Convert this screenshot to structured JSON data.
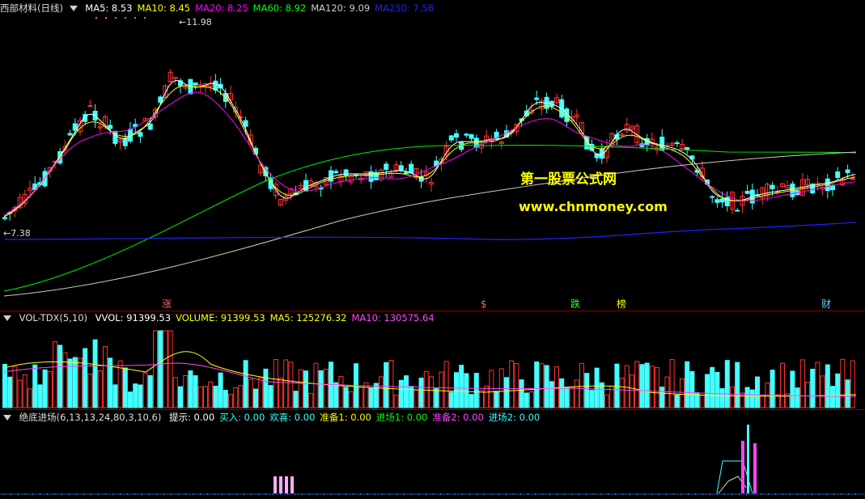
{
  "main_panel": {
    "title": "西部材料(日线)",
    "ma": [
      {
        "label": "MA5: 8.53",
        "color": "#ffffff"
      },
      {
        "label": "MA10: 8.45",
        "color": "#ffff00"
      },
      {
        "label": "MA20: 8.25",
        "color": "#ff00ff"
      },
      {
        "label": "MA60: 8.92",
        "color": "#00ff00"
      },
      {
        "label": "MA120: 9.09",
        "color": "#cccccc"
      },
      {
        "label": "MA250: 7.58",
        "color": "#2020ff"
      }
    ],
    "high_label": "11.98",
    "low_label": "7.38",
    "watermark_title": "第一股票公式网",
    "watermark_url": "www.chnmoney.com",
    "event_markers": [
      "涨",
      "$",
      "跌",
      "榜",
      "财"
    ]
  },
  "volume_panel": {
    "title": "VOL-TDX(5,10)",
    "items": [
      {
        "label": "VVOL: 91399.53",
        "color": "#ffffff"
      },
      {
        "label": "VOLUME: 91399.53",
        "color": "#ffff00"
      },
      {
        "label": "MA5: 125276.32",
        "color": "#ffff00"
      },
      {
        "label": "MA10: 130575.64",
        "color": "#ff44ff"
      }
    ]
  },
  "indicator_panel": {
    "title": "绝底进场(6,13,13,24,80,3,10,6)",
    "items": [
      {
        "label": "提示: 0.00",
        "color": "#ffffff"
      },
      {
        "label": "买入: 0.00",
        "color": "#33ffff"
      },
      {
        "label": "欢喜: 0.00",
        "color": "#33ffff"
      },
      {
        "label": "准备1: 0.00",
        "color": "#ffff00"
      },
      {
        "label": "进场1: 0.00",
        "color": "#00ff00"
      },
      {
        "label": "准备2: 0.00",
        "color": "#ff44ff"
      },
      {
        "label": "进场2: 0.00",
        "color": "#33ffff"
      }
    ]
  },
  "colors": {
    "up": "#ff3333",
    "down": "#44ffff",
    "background": "#000000",
    "separator": "#8a0000"
  }
}
